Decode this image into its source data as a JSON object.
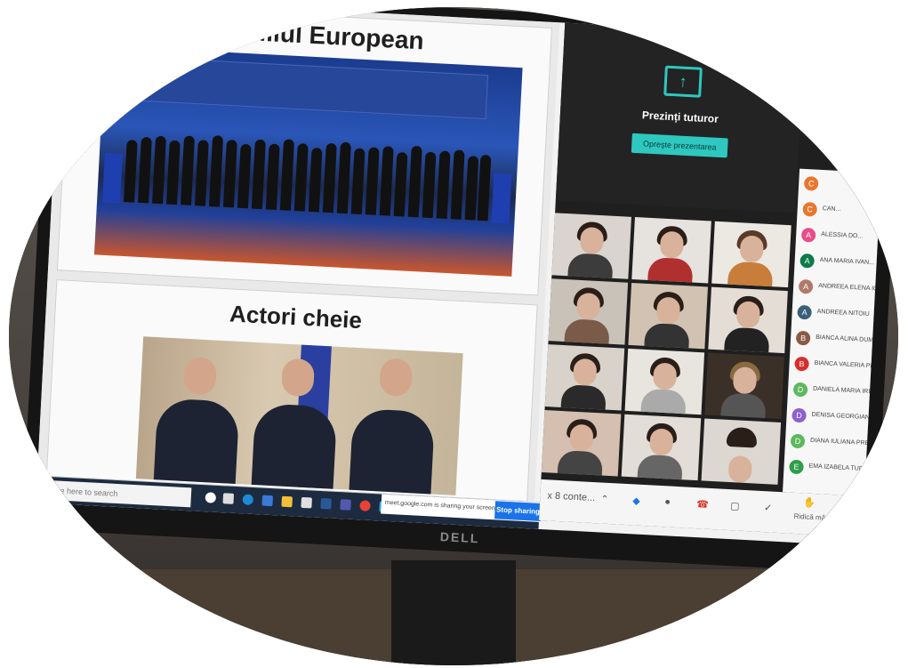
{
  "slide1": {
    "title": "Consiliul European"
  },
  "slide2": {
    "title": "Actori cheie"
  },
  "meet": {
    "present_label": "Prezinți tuturor",
    "stop_presenting": "Opreşte prezentarea",
    "toolbar": {
      "more": "x 8 conte...",
      "raise_hand": "Ridică mâna"
    }
  },
  "participants": [
    {
      "initial": "C",
      "name": "",
      "color": "#e8772e"
    },
    {
      "initial": "C",
      "name": "CAN...",
      "color": "#e8772e"
    },
    {
      "initial": "A",
      "name": "ALESSIA DO...",
      "color": "#e84d8a"
    },
    {
      "initial": "A",
      "name": "ANA MARIA IVAN...",
      "color": "#0e7a4a"
    },
    {
      "initial": "A",
      "name": "ANDREEA ELENA ION...",
      "color": "#b07a6a"
    },
    {
      "initial": "A",
      "name": "ANDREEA NITOIU",
      "color": "#3b5f7a"
    },
    {
      "initial": "B",
      "name": "BIANCA ALINA DUMITR...",
      "color": "#8a5a44"
    },
    {
      "initial": "B",
      "name": "BIANCA VALERIA PETR...",
      "color": "#d92d2d"
    },
    {
      "initial": "D",
      "name": "DANIELA MARIA IRINA...",
      "color": "#5cb85c"
    },
    {
      "initial": "D",
      "name": "DENISA GEORGIANA C...",
      "color": "#8e5fd0"
    },
    {
      "initial": "D",
      "name": "DIANA IULIANA PREDA...",
      "color": "#5cb85c"
    },
    {
      "initial": "E",
      "name": "EMA IZABELA TUDOR...",
      "color": "#2e9e4a"
    }
  ],
  "taskbar": {
    "search_placeholder": "Type here to search",
    "share_message": "meet.google.com is sharing your screen.",
    "stop_sharing": "Stop sharing"
  },
  "monitor_brand": "DELL"
}
